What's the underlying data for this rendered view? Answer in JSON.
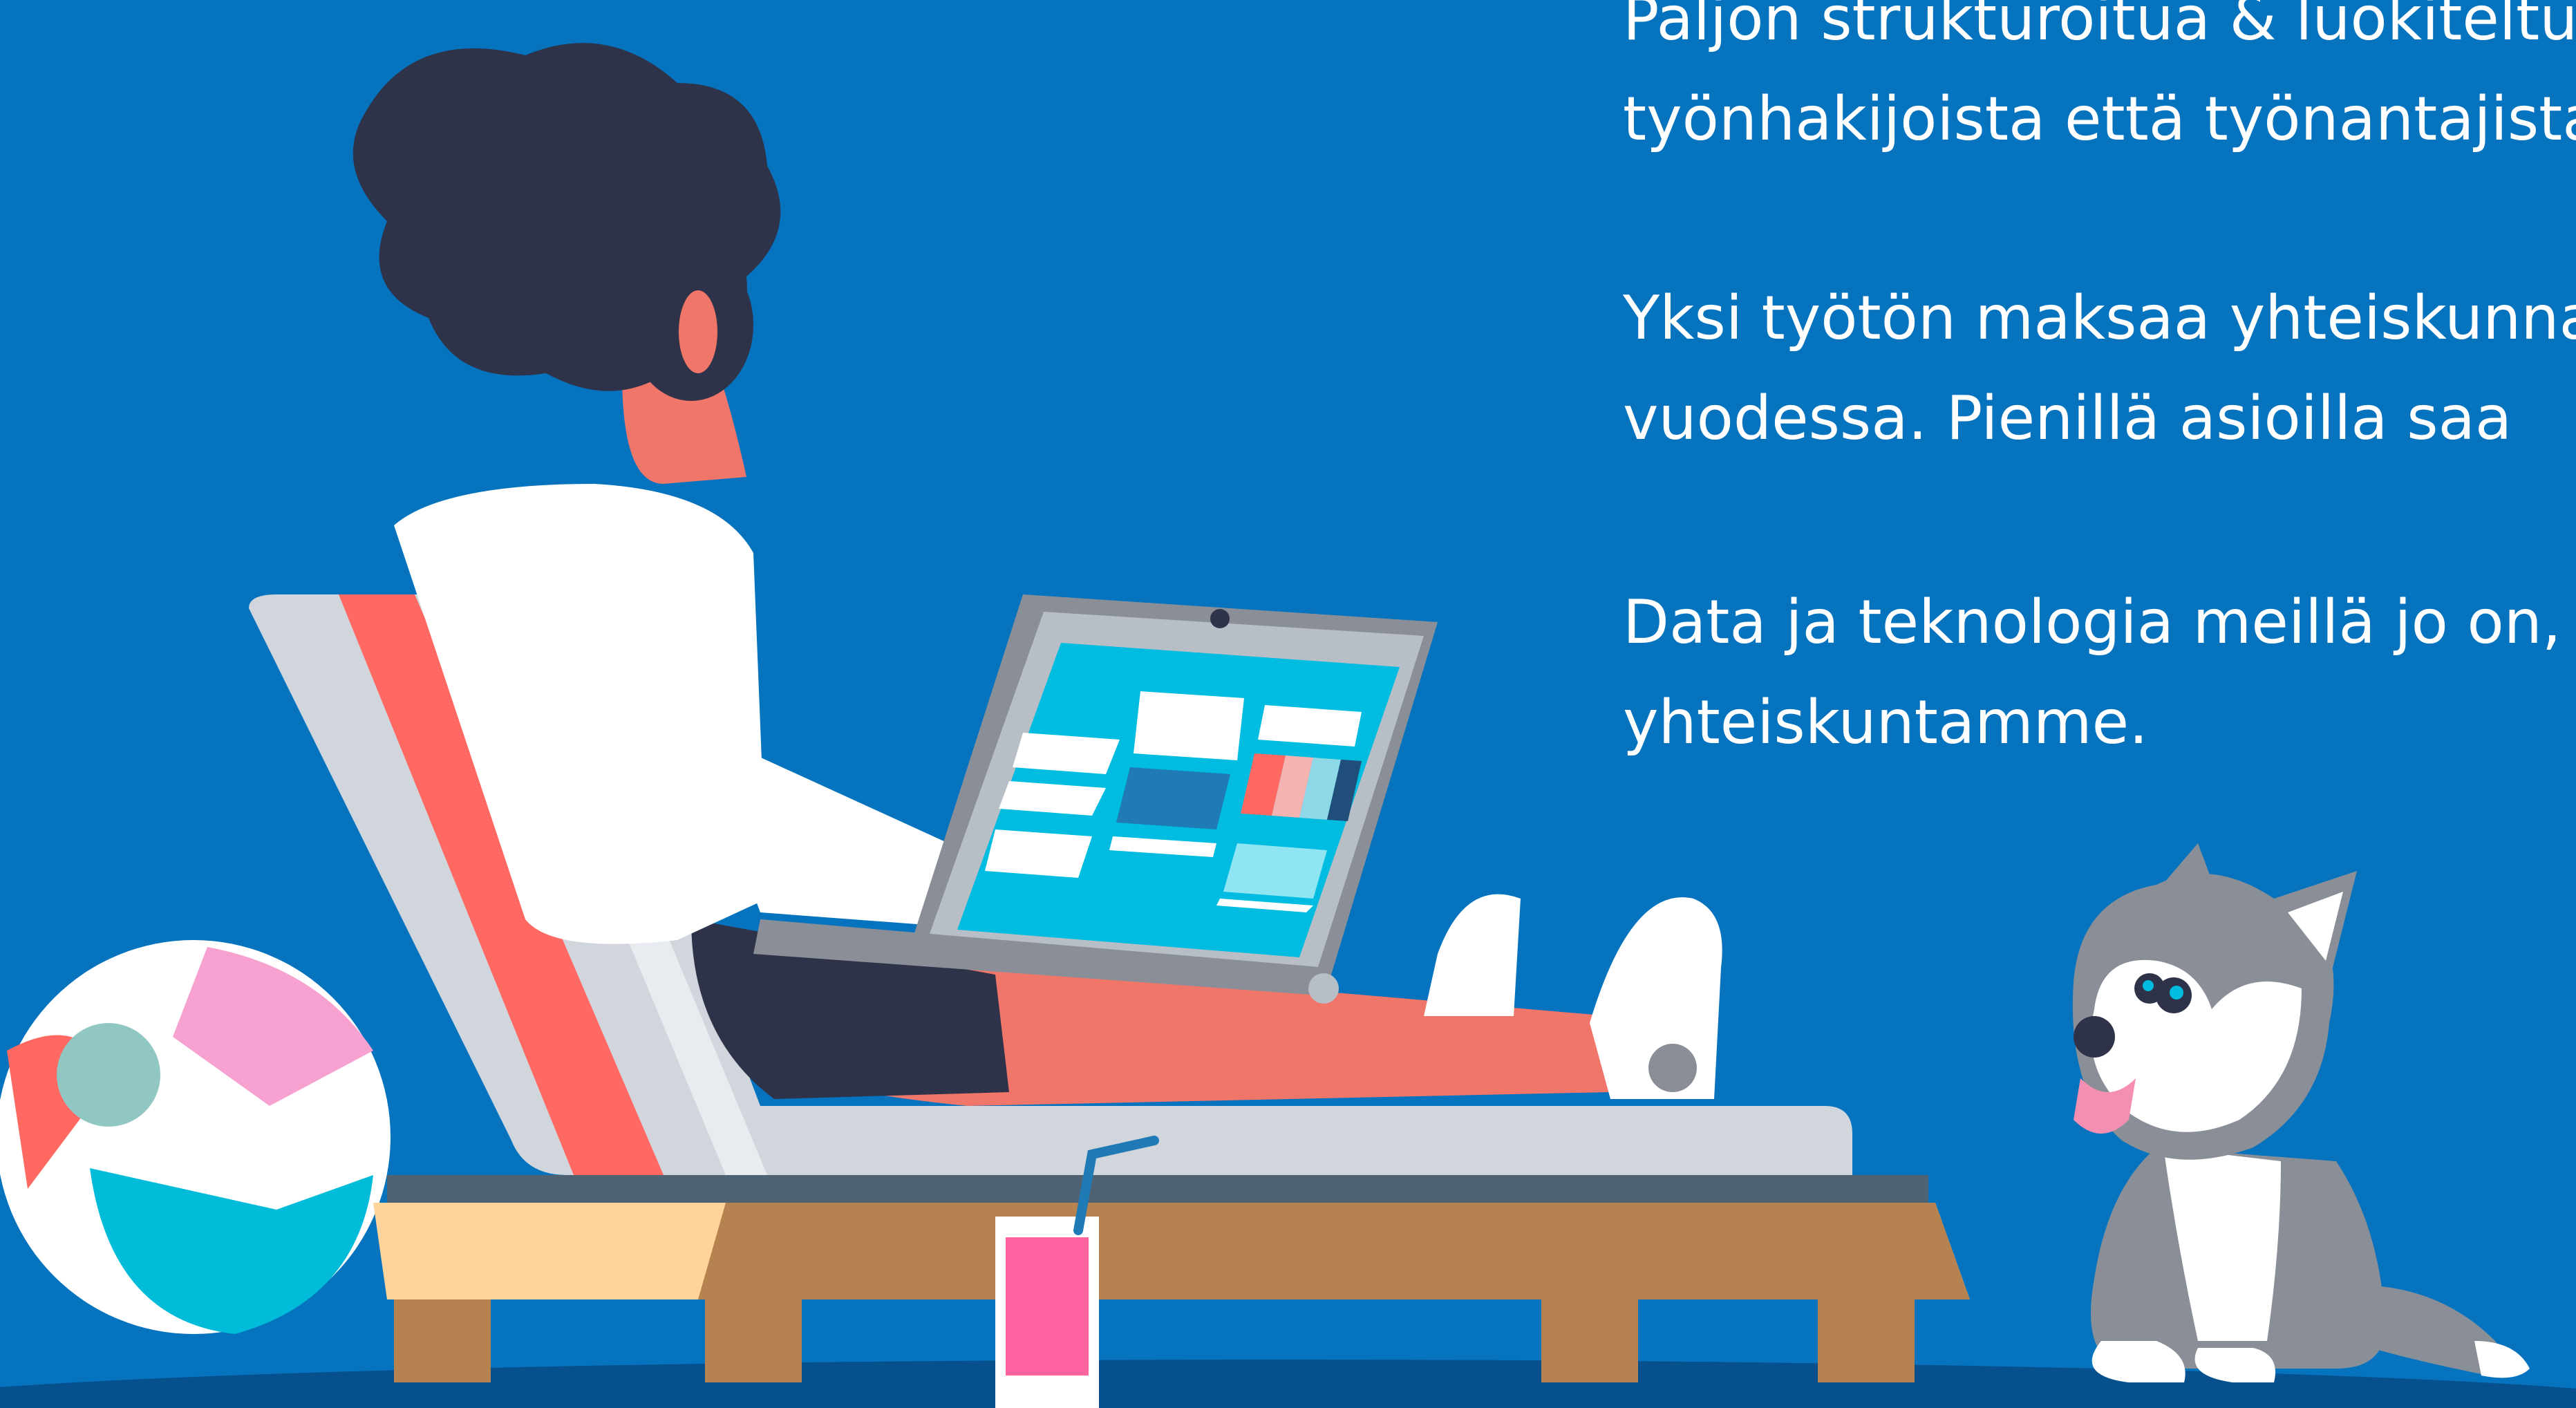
{
  "bullets": [
    {
      "lines": [
        "Paljon strukturoitua & luokiteltua",
        "työnhakijoista että työnantajista"
      ]
    },
    {
      "lines": [
        "Yksi työtön maksaa yhteiskunnalle",
        "vuodessa. Pienillä asioilla saa"
      ]
    },
    {
      "lines": [
        "Data ja teknologia meillä jo on,",
        "yhteiskuntamme."
      ]
    }
  ],
  "colors": {
    "background": "#0673bf",
    "text": "#ffffff",
    "ground_shadow": "#06508d"
  },
  "illustration": {
    "icons": [
      "person-with-laptop-icon",
      "lounge-chair-icon",
      "beach-ball-icon",
      "pink-drink-icon",
      "husky-dog-icon"
    ]
  }
}
